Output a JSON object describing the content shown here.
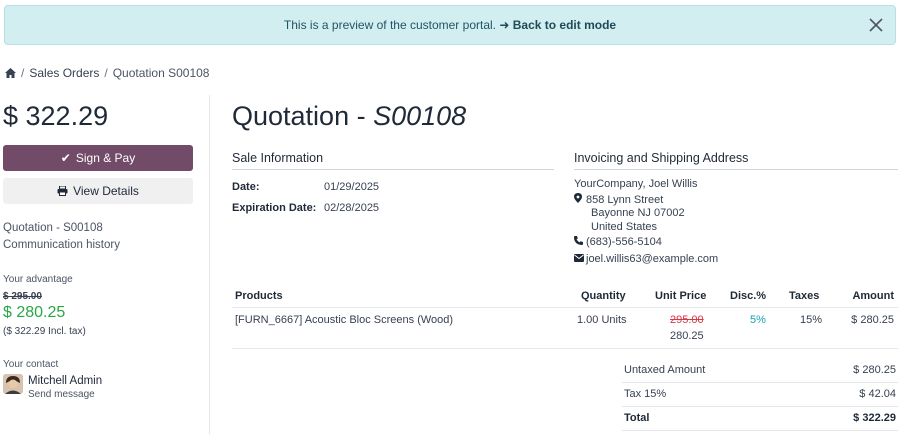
{
  "banner": {
    "text": "This is a preview of the customer portal.",
    "link": "Back to edit mode"
  },
  "breadcrumb": {
    "items": [
      "Sales Orders",
      "Quotation S00108"
    ]
  },
  "sidebar": {
    "amount": "$ 322.29",
    "sign_pay_label": "Sign & Pay",
    "view_details_label": "View Details",
    "links": [
      "Quotation - S00108",
      "Communication history"
    ],
    "advantage_label": "Your advantage",
    "old_price": "$ 295.00",
    "new_price": "$ 280.25",
    "incl_tax": "($ 322.29 Incl. tax)",
    "contact_label": "Your contact",
    "contact_name": "Mitchell Admin",
    "send_message": "Send message"
  },
  "main": {
    "title_prefix": "Quotation - ",
    "title_ref": "S00108",
    "sale_info_heading": "Sale Information",
    "date_label": "Date:",
    "date_value": "01/29/2025",
    "expiration_label": "Expiration Date:",
    "expiration_value": "02/28/2025",
    "address_heading": "Invoicing and Shipping Address",
    "address_name": "YourCompany, Joel Willis",
    "address_street": "858 Lynn Street",
    "address_city": "Bayonne NJ 07002",
    "address_country": "United States",
    "phone": "(683)-556-5104",
    "email": "joel.willis63@example.com"
  },
  "table": {
    "headers": [
      "Products",
      "Quantity",
      "Unit Price",
      "Disc.%",
      "Taxes",
      "Amount"
    ],
    "row": {
      "product": "[FURN_6667] Acoustic Bloc Screens (Wood)",
      "quantity": "1.00 Units",
      "unit_price_old": "295.00",
      "unit_price_new": "280.25",
      "discount": "5%",
      "taxes": "15%",
      "amount": "$ 280.25"
    }
  },
  "totals": {
    "untaxed_label": "Untaxed Amount",
    "untaxed_value": "$ 280.25",
    "tax_label": "Tax 15%",
    "tax_value": "$ 42.04",
    "total_label": "Total",
    "total_value": "$ 322.29"
  },
  "colors": {
    "brand": "#714b67",
    "banner_bg": "#d2eef1",
    "discount_price": "#28a745",
    "strike_red": "#dc3545",
    "disc_blue": "#17a2b8"
  }
}
